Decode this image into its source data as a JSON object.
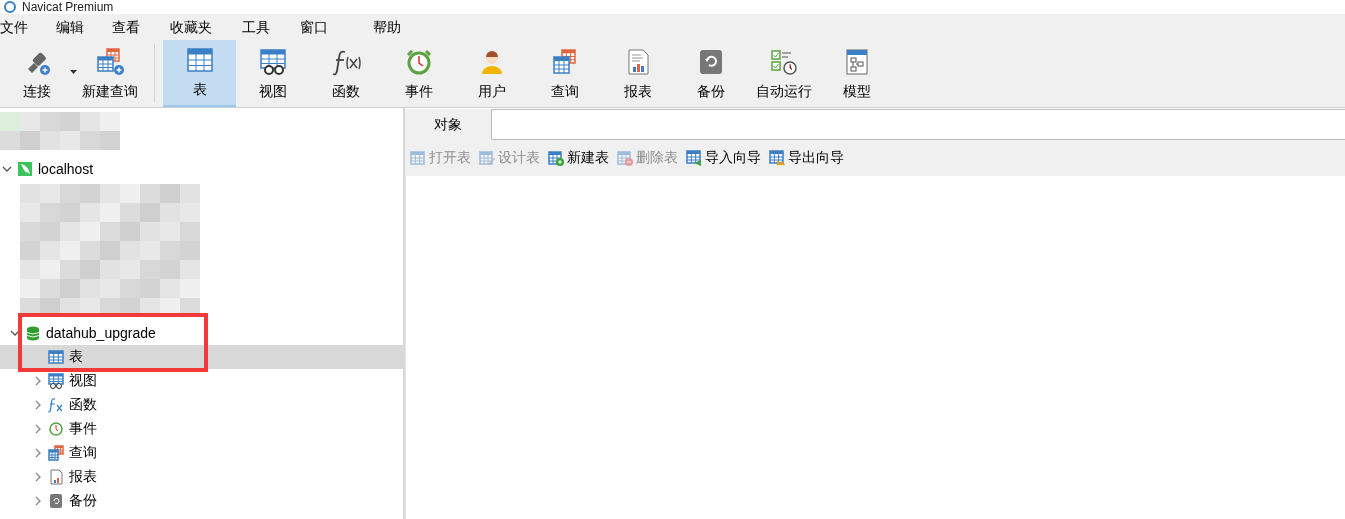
{
  "window": {
    "title": "Navicat Premium"
  },
  "menu": [
    "文件",
    "编辑",
    "查看",
    "收藏夹",
    "工具",
    "窗口",
    "帮助"
  ],
  "toolbar": [
    {
      "label": "连接",
      "selected": false,
      "dropdown": true
    },
    {
      "label": "新建查询",
      "selected": false
    },
    {
      "label": "表",
      "selected": true
    },
    {
      "label": "视图",
      "selected": false
    },
    {
      "label": "函数",
      "selected": false
    },
    {
      "label": "事件",
      "selected": false
    },
    {
      "label": "用户",
      "selected": false
    },
    {
      "label": "查询",
      "selected": false
    },
    {
      "label": "报表",
      "selected": false
    },
    {
      "label": "备份",
      "selected": false
    },
    {
      "label": "自动运行",
      "selected": false
    },
    {
      "label": "模型",
      "selected": false
    }
  ],
  "tree": [
    {
      "kind": "redacted"
    },
    {
      "kind": "server",
      "label": "localhost",
      "expanded": true,
      "selected": false,
      "children": [
        {
          "kind": "redacted"
        },
        {
          "kind": "database",
          "label": "datahub_upgrade",
          "expanded": true,
          "selected": false,
          "highlighted": true,
          "children": [
            {
              "kind": "table",
              "label": "表",
              "selected": true
            },
            {
              "kind": "view",
              "label": "视图",
              "expanded": false,
              "selected": false
            },
            {
              "kind": "function",
              "label": "函数",
              "expanded": false,
              "selected": false
            },
            {
              "kind": "event",
              "label": "事件",
              "expanded": false,
              "selected": false
            },
            {
              "kind": "query",
              "label": "查询",
              "expanded": false,
              "selected": false
            },
            {
              "kind": "report",
              "label": "报表",
              "expanded": false,
              "selected": false
            },
            {
              "kind": "backup",
              "label": "备份",
              "expanded": false,
              "selected": false
            }
          ]
        }
      ]
    }
  ],
  "tabs": [
    {
      "label": "对象",
      "selected": true
    }
  ],
  "actions": [
    {
      "label": "打开表",
      "disabled": true
    },
    {
      "label": "设计表",
      "disabled": true
    },
    {
      "label": "新建表",
      "disabled": false
    },
    {
      "label": "删除表",
      "disabled": true
    },
    {
      "label": "导入向导",
      "disabled": false
    },
    {
      "label": "导出向导",
      "disabled": false
    }
  ]
}
